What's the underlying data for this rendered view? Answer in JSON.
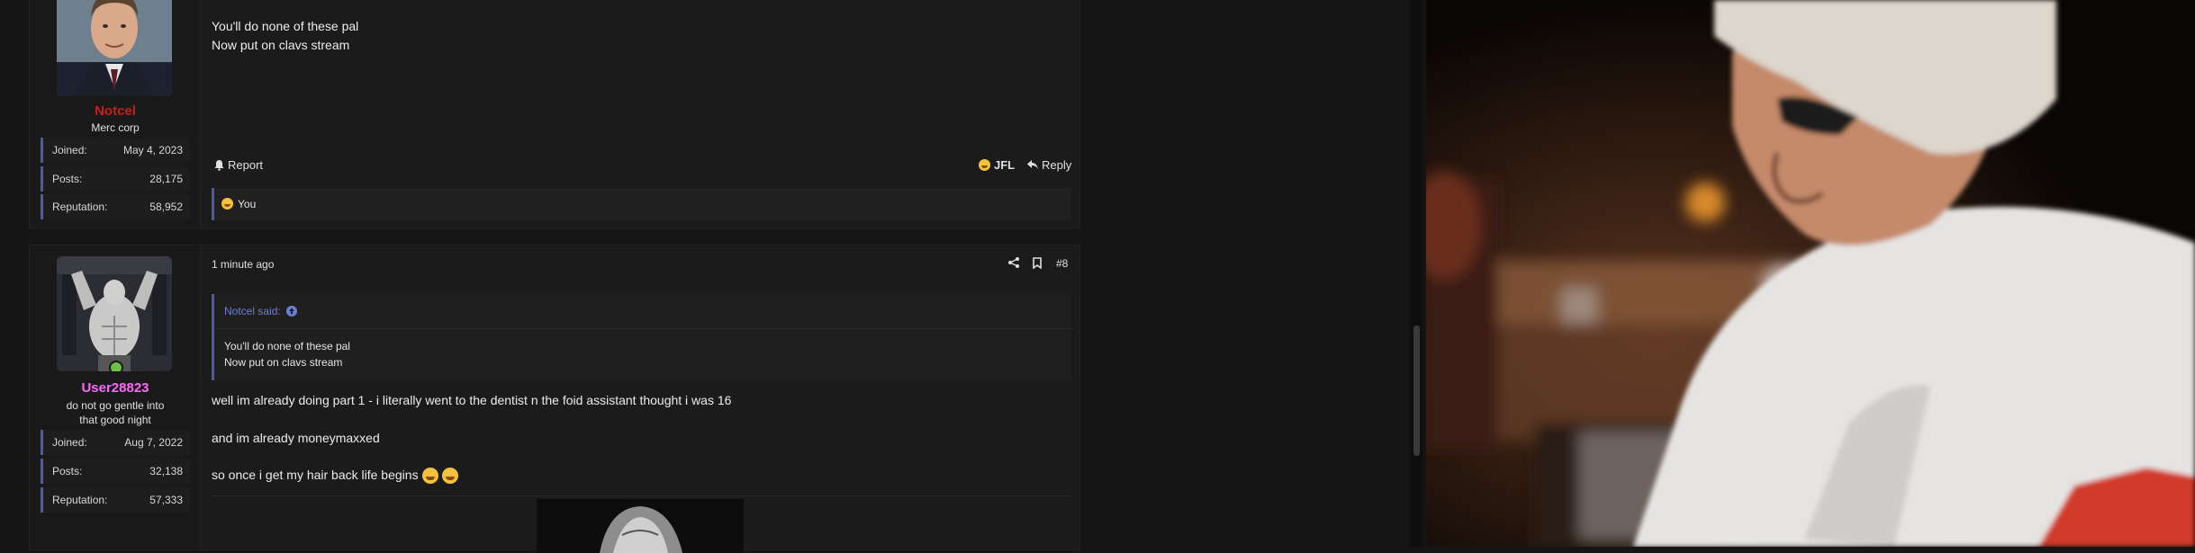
{
  "post1": {
    "username": "Notcel",
    "user_title": "Merc corp",
    "stats": [
      {
        "key": "Joined:",
        "value": "May 4, 2023"
      },
      {
        "key": "Posts:",
        "value": "28,175"
      },
      {
        "key": "Reputation:",
        "value": "58,952"
      }
    ],
    "message_lines": [
      "You'll do none of these pal",
      "Now put on clavs stream"
    ],
    "report_label": "Report",
    "reaction_label": "JFL",
    "reply_label": "Reply",
    "reaction_summary": "You"
  },
  "post2": {
    "username": "User28823",
    "user_title": "do not go gentle into that good night",
    "stats": [
      {
        "key": "Joined:",
        "value": "Aug 7, 2022"
      },
      {
        "key": "Posts:",
        "value": "32,138"
      },
      {
        "key": "Reputation:",
        "value": "57,333"
      }
    ],
    "timestamp": "1 minute ago",
    "post_number": "#8",
    "quote": {
      "author": "Notcel said:",
      "lines": [
        "You'll do none of these pal",
        "Now put on clavs stream"
      ]
    },
    "message_lines": [
      "well im already doing part 1 - i literally went to the dentist n the foid assistant thought i was 16",
      "and im already moneymaxxed",
      "so once i get my hair back life begins"
    ]
  },
  "colors": {
    "username_red": "#c81e1e",
    "username_pink": "#ff66ff",
    "accent_blue": "#4a5aa8",
    "online_green": "#6cc04a"
  }
}
